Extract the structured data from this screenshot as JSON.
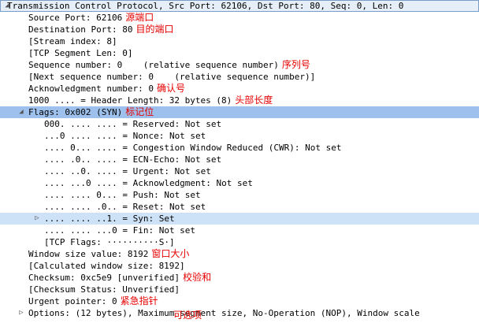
{
  "rows": [
    {
      "indent": 0,
      "text": "Transmission Control Protocol, Src Port: 62106, Dst Port: 80, Seq: 0, Len: 0",
      "ann": "",
      "style": "top",
      "exp": "down"
    },
    {
      "indent": 1,
      "text": "Source Port: 62106",
      "ann": "源端口",
      "style": "",
      "exp": ""
    },
    {
      "indent": 1,
      "text": "Destination Port: 80",
      "ann": "目的端口",
      "style": "",
      "exp": ""
    },
    {
      "indent": 1,
      "text": "[Stream index: 8]",
      "ann": "",
      "style": "",
      "exp": ""
    },
    {
      "indent": 1,
      "text": "[TCP Segment Len: 0]",
      "ann": "",
      "style": "",
      "exp": ""
    },
    {
      "indent": 1,
      "text": "Sequence number: 0    (relative sequence number)",
      "ann": "序列号",
      "style": "",
      "exp": ""
    },
    {
      "indent": 1,
      "text": "[Next sequence number: 0    (relative sequence number)]",
      "ann": "",
      "style": "",
      "exp": ""
    },
    {
      "indent": 1,
      "text": "Acknowledgment number: 0",
      "ann": "确认号",
      "style": "",
      "exp": ""
    },
    {
      "indent": 1,
      "text": "1000 .... = Header Length: 32 bytes (8)",
      "ann": "头部长度",
      "style": "",
      "exp": ""
    },
    {
      "indent": 1,
      "text": "Flags: 0x002 (SYN)",
      "ann": "标记位",
      "style": "flags",
      "exp": "down"
    },
    {
      "indent": 2,
      "text": "000. .... .... = Reserved: Not set",
      "ann": "",
      "style": "",
      "exp": ""
    },
    {
      "indent": 2,
      "text": "...0 .... .... = Nonce: Not set",
      "ann": "",
      "style": "",
      "exp": ""
    },
    {
      "indent": 2,
      "text": ".... 0... .... = Congestion Window Reduced (CWR): Not set",
      "ann": "",
      "style": "",
      "exp": ""
    },
    {
      "indent": 2,
      "text": ".... .0.. .... = ECN-Echo: Not set",
      "ann": "",
      "style": "",
      "exp": ""
    },
    {
      "indent": 2,
      "text": ".... ..0. .... = Urgent: Not set",
      "ann": "",
      "style": "",
      "exp": ""
    },
    {
      "indent": 2,
      "text": ".... ...0 .... = Acknowledgment: Not set",
      "ann": "",
      "style": "",
      "exp": ""
    },
    {
      "indent": 2,
      "text": ".... .... 0... = Push: Not set",
      "ann": "",
      "style": "",
      "exp": ""
    },
    {
      "indent": 2,
      "text": ".... .... .0.. = Reset: Not set",
      "ann": "",
      "style": "",
      "exp": ""
    },
    {
      "indent": 2,
      "text": ".... .... ..1. = Syn: Set",
      "ann": "",
      "style": "syn",
      "exp": "right"
    },
    {
      "indent": 2,
      "text": ".... .... ...0 = Fin: Not set",
      "ann": "",
      "style": "",
      "exp": ""
    },
    {
      "indent": 2,
      "text": "[TCP Flags: ··········S·]",
      "ann": "",
      "style": "",
      "exp": ""
    },
    {
      "indent": 1,
      "text": "Window size value: 8192",
      "ann": "窗口大小",
      "style": "",
      "exp": ""
    },
    {
      "indent": 1,
      "text": "[Calculated window size: 8192]",
      "ann": "",
      "style": "",
      "exp": ""
    },
    {
      "indent": 1,
      "text": "Checksum: 0xc5e9 [unverified]",
      "ann": "校验和",
      "style": "",
      "exp": ""
    },
    {
      "indent": 1,
      "text": "[Checksum Status: Unverified]",
      "ann": "",
      "style": "",
      "exp": ""
    },
    {
      "indent": 1,
      "text": "Urgent pointer: 0",
      "ann": "紧急指针",
      "style": "",
      "exp": ""
    },
    {
      "indent": 1,
      "text": "Options: (12 bytes), Maximum segment size, No-Operation (NOP), Window scale",
      "ann": "",
      "style": "",
      "exp": "right"
    }
  ],
  "options_overlay": "可选项",
  "colors": {
    "annotation": "#e60000",
    "flags_bg": "#9dc1ec",
    "syn_bg": "#cde1f7"
  }
}
